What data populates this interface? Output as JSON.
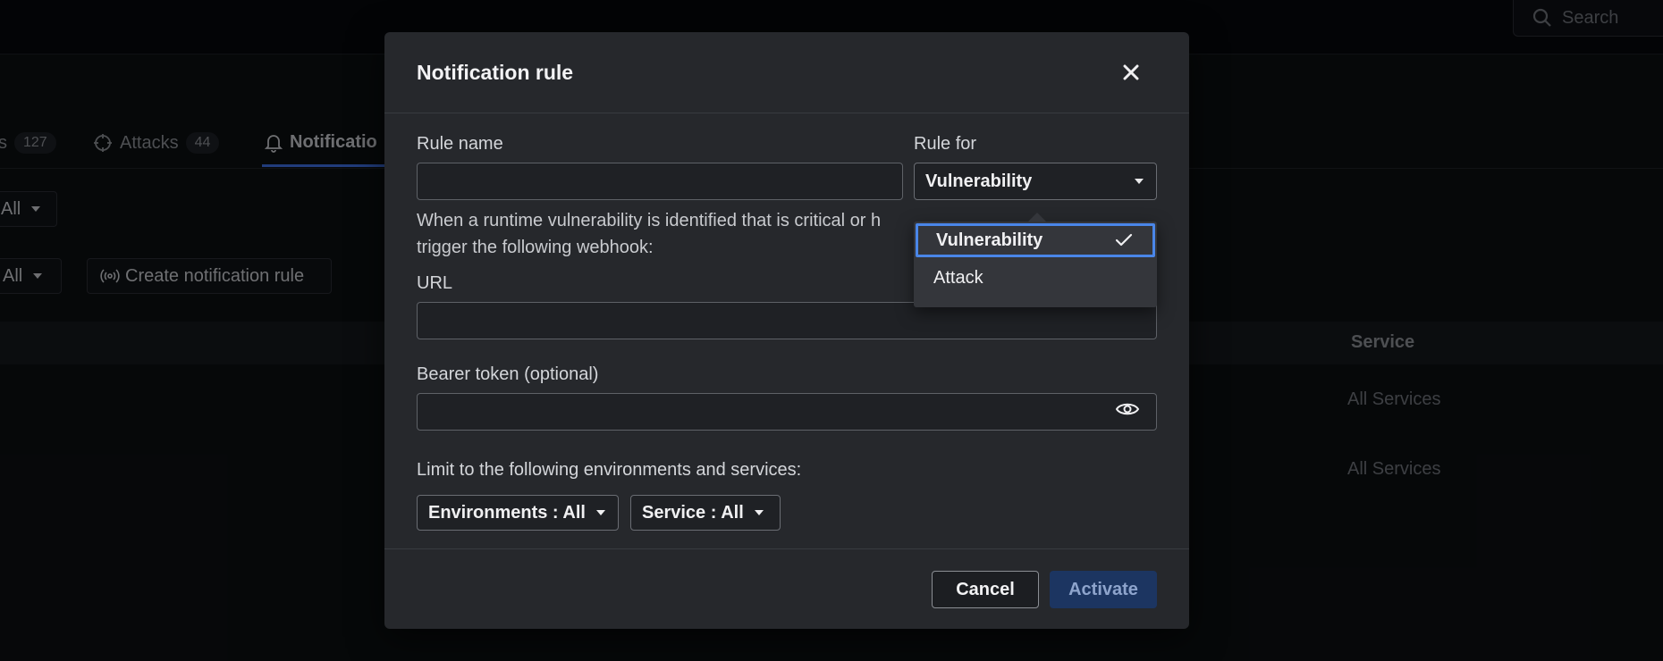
{
  "background": {
    "search": {
      "label": "Search"
    },
    "tabs": [
      {
        "label": "s",
        "count": "127"
      },
      {
        "label": "Attacks",
        "count": "44"
      },
      {
        "label": "Notificatio"
      }
    ],
    "filters": {
      "filter1": "All",
      "filter2": "All",
      "create_button": "Create notification rule"
    },
    "table": {
      "column_service": "Service",
      "rows": [
        "All Services",
        "All Services"
      ]
    }
  },
  "modal": {
    "title": "Notification rule",
    "rule_name_label": "Rule name",
    "rule_name_value": "",
    "rule_for_label": "Rule for",
    "rule_for_value": "Vulnerability",
    "description_line1": "When a runtime vulnerability is identified that is critical or h",
    "description_line2": "trigger the following webhook:",
    "url_label": "URL",
    "url_value": "",
    "bearer_label": "Bearer token (optional)",
    "bearer_value": "",
    "limit_label": "Limit to the following environments and services:",
    "environments_button": "Environments : All",
    "service_button": "Service : All",
    "cancel_label": "Cancel",
    "activate_label": "Activate",
    "rule_for_options": [
      {
        "label": "Vulnerability",
        "selected": true
      },
      {
        "label": "Attack",
        "selected": false
      }
    ]
  },
  "colors": {
    "accent": "#4a86e8",
    "activate_bg": "#1c3561",
    "modal_bg": "#26282c"
  }
}
